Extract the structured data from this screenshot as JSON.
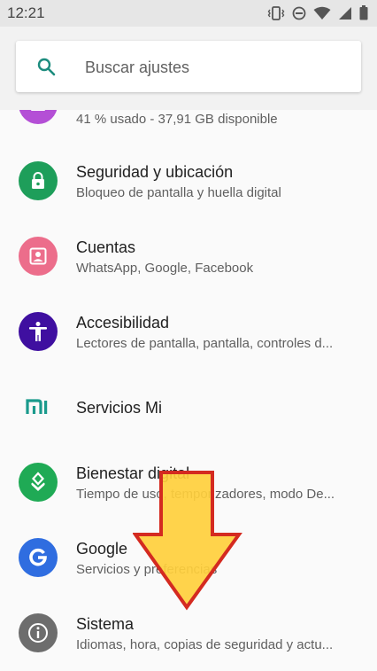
{
  "status_bar": {
    "time": "12:21"
  },
  "search": {
    "placeholder": "Buscar ajustes"
  },
  "items": [
    {
      "key": "storage",
      "subtitle": "41 % usado - 37,91 GB disponible",
      "color": "#b44fd6"
    },
    {
      "key": "security",
      "title": "Seguridad y ubicación",
      "subtitle": "Bloqueo de pantalla y huella digital",
      "color": "#1e9e5a",
      "icon": "lock-icon"
    },
    {
      "key": "accounts",
      "title": "Cuentas",
      "subtitle": "WhatsApp, Google, Facebook",
      "color": "#ec6d8b",
      "icon": "account-box-icon"
    },
    {
      "key": "accessibility",
      "title": "Accesibilidad",
      "subtitle": "Lectores de pantalla, pantalla, controles d...",
      "color": "#3f0fa0",
      "icon": "accessibility-icon"
    },
    {
      "key": "mi",
      "title": "Servicios Mi",
      "color": "#1a9a8c",
      "icon": "mi-logo-icon"
    },
    {
      "key": "wellbeing",
      "title": "Bienestar digital",
      "subtitle": "Tiempo de uso, temporizadores, modo De...",
      "color": "#1faa55",
      "icon": "wellbeing-icon"
    },
    {
      "key": "google",
      "title": "Google",
      "subtitle": "Servicios y preferencias",
      "color": "#2f6de0",
      "icon": "google-icon"
    },
    {
      "key": "system",
      "title": "Sistema",
      "subtitle": "Idiomas, hora, copias de seguridad y actu...",
      "color": "#6d6d6d",
      "icon": "info-icon"
    }
  ],
  "overlay": {
    "arrow_color": "#ffcf3c",
    "arrow_border": "#d42a20"
  }
}
